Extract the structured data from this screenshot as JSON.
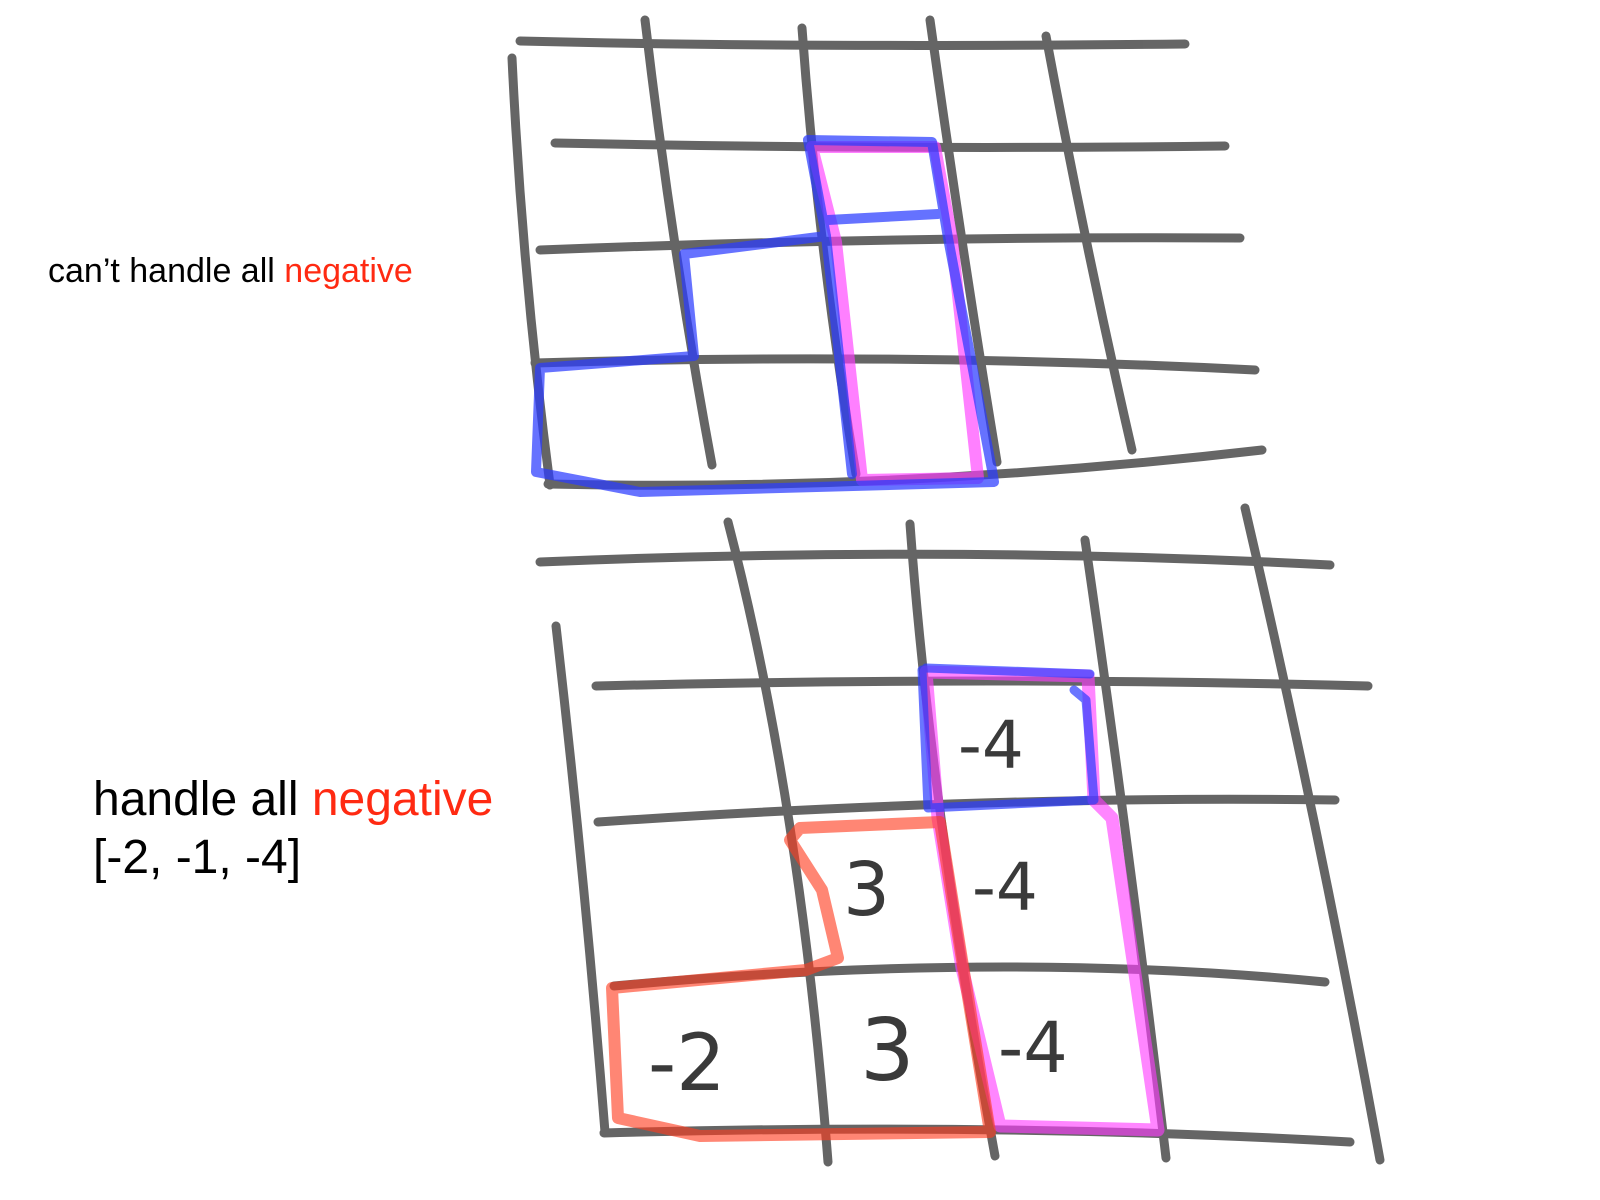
{
  "diagram": {
    "top_caption": {
      "prefix": "can’t handle all ",
      "highlight": "negative"
    },
    "bottom_caption": {
      "prefix": "handle all ",
      "highlight": "negative"
    },
    "array_text": "[-2, -1, -4]",
    "cell_values": {
      "top_right": "-4",
      "mid_left": "3",
      "mid_right": "-4",
      "bot_left": "-2",
      "bot_mid": "3",
      "bot_right": "-4"
    },
    "colors": {
      "grid": "#2b2b2b",
      "blue": "#2b3cff",
      "magenta": "#ff3cff",
      "red": "#ff3b1f",
      "caption_red": "#ff2a12"
    }
  }
}
